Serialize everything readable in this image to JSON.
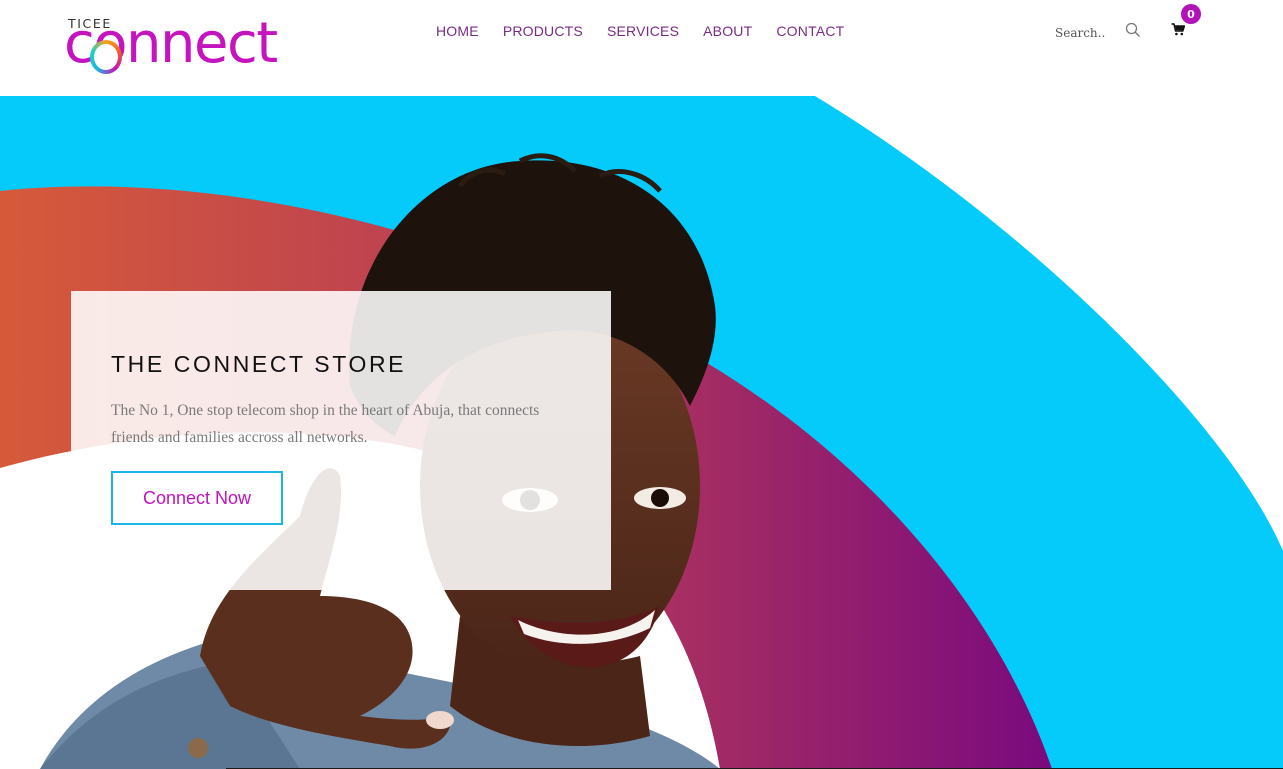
{
  "brand": {
    "top_text": "TICEE",
    "word": "connect",
    "colors": {
      "primary": "#c413bf",
      "ring_orange": "#f7a21b",
      "ring_cyan": "#1fb6e6"
    }
  },
  "nav": {
    "items": [
      {
        "label": "HOME"
      },
      {
        "label": "PRODUCTS"
      },
      {
        "label": "SERVICES"
      },
      {
        "label": "ABOUT"
      },
      {
        "label": "CONTACT"
      }
    ],
    "color": "#7a2a86"
  },
  "search": {
    "placeholder": "Search..",
    "icon": "search-icon"
  },
  "cart": {
    "count": "0",
    "icon": "shopping-cart-icon",
    "badge_color": "#b212b8"
  },
  "hero": {
    "title": "THE CONNECT STORE",
    "text": "The No 1, One stop telecom shop in the heart of Abuja, that connects friends and families accross all networks.",
    "cta_label": "Connect Now",
    "colors": {
      "sky": "#05cbfb",
      "purple": "#7a0a7e",
      "orange": "#d65a3a",
      "border": "#1ab6e6"
    },
    "image": "woman-phone-gesture-photo"
  }
}
